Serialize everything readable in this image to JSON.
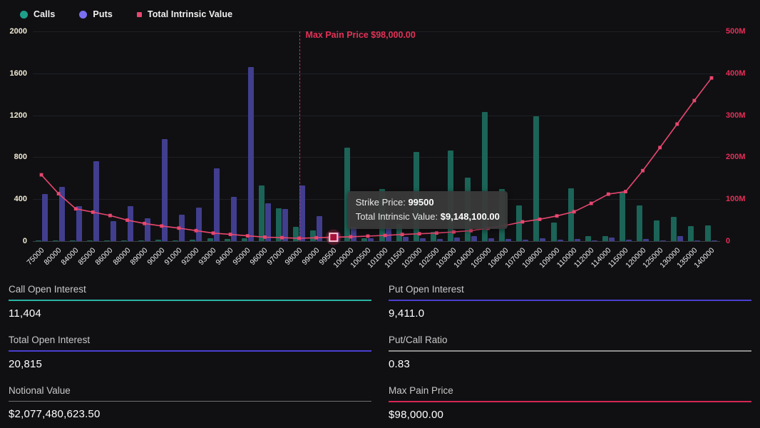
{
  "legend": {
    "items": [
      {
        "label": "Calls",
        "color": "#1f9e8c",
        "shape": "circle"
      },
      {
        "label": "Puts",
        "color": "#7a6ff0",
        "shape": "circle"
      },
      {
        "label": "Total Intrinsic Value",
        "color": "#e8476f",
        "shape": "square"
      }
    ]
  },
  "chart_data": {
    "type": "bar+line",
    "title": "",
    "categories": [
      "75000",
      "80000",
      "84000",
      "85000",
      "86000",
      "88000",
      "89000",
      "90000",
      "91000",
      "92000",
      "93000",
      "94000",
      "95000",
      "96000",
      "97000",
      "98000",
      "99000",
      "99500",
      "100000",
      "100500",
      "101000",
      "101500",
      "102000",
      "102500",
      "103000",
      "104000",
      "105000",
      "106000",
      "107000",
      "108000",
      "109000",
      "110000",
      "112000",
      "114000",
      "115000",
      "120000",
      "125000",
      "130000",
      "135000",
      "140000"
    ],
    "series": [
      {
        "name": "Calls",
        "type": "bar",
        "axis": "left",
        "color": "#1b6457",
        "values": [
          5,
          5,
          5,
          10,
          5,
          10,
          10,
          15,
          10,
          15,
          25,
          20,
          30,
          530,
          310,
          135,
          100,
          50,
          890,
          30,
          500,
          160,
          850,
          90,
          865,
          605,
          1230,
          500,
          340,
          1190,
          175,
          505,
          45,
          50,
          460,
          340,
          195,
          230,
          140,
          150
        ]
      },
      {
        "name": "Puts",
        "type": "bar",
        "axis": "left",
        "color": "#413e8e",
        "values": [
          450,
          515,
          330,
          765,
          190,
          330,
          220,
          970,
          255,
          320,
          695,
          420,
          1660,
          360,
          305,
          530,
          235,
          80,
          135,
          25,
          120,
          40,
          30,
          20,
          35,
          45,
          30,
          20,
          15,
          25,
          15,
          20,
          10,
          36,
          15,
          20,
          10,
          50,
          10,
          10
        ]
      },
      {
        "name": "Total Intrinsic Value",
        "type": "line",
        "axis": "right",
        "color": "#e8476f",
        "values_millions": [
          158,
          113,
          77,
          69,
          61,
          50,
          42,
          36,
          31,
          25,
          19,
          16,
          12.5,
          9.5,
          8.2,
          6.8,
          8.0,
          9.148,
          10.3,
          11.9,
          13.6,
          15.9,
          17.6,
          19.3,
          22,
          25,
          30.6,
          37.4,
          46,
          52,
          60,
          70,
          90,
          112,
          118,
          168,
          223,
          279,
          335,
          389
        ]
      }
    ],
    "left_axis": {
      "ticks": [
        0,
        400,
        800,
        1200,
        1600,
        2000
      ],
      "max": 2000
    },
    "right_axis": {
      "tick_labels": [
        "0",
        "100M",
        "200M",
        "300M",
        "400M",
        "500M"
      ],
      "tick_values_millions": [
        0,
        100,
        200,
        300,
        400,
        500
      ],
      "max_millions": 500
    },
    "annotation": {
      "label": "Max Pain Price $98,000.00",
      "x": "98000",
      "color": "#e43257"
    },
    "highlight": {
      "x": "99500"
    },
    "legend_position": "top-left",
    "grid": true
  },
  "tooltip": {
    "line1_label": "Strike Price: ",
    "line1_value": "99500",
    "line2_label": "Total Intrinsic Value: ",
    "line2_value": "$9,148,100.00"
  },
  "stats": {
    "call_oi": {
      "label": "Call Open Interest",
      "value": "11,404",
      "underline": "#2bb3a3"
    },
    "put_oi": {
      "label": "Put Open Interest",
      "value": "9,411.0",
      "underline": "#4a3fd0"
    },
    "total_oi": {
      "label": "Total Open Interest",
      "value": "20,815",
      "underline": "#4a3fd0"
    },
    "put_call": {
      "label": "Put/Call Ratio",
      "value": "0.83",
      "underline": "#8f8f8f"
    },
    "notional": {
      "label": "Notional Value",
      "value": "$2,077,480,623.50",
      "underline": "#6e6e6e"
    },
    "max_pain": {
      "label": "Max Pain Price",
      "value": "$98,000.00",
      "underline": "#d62755"
    }
  }
}
